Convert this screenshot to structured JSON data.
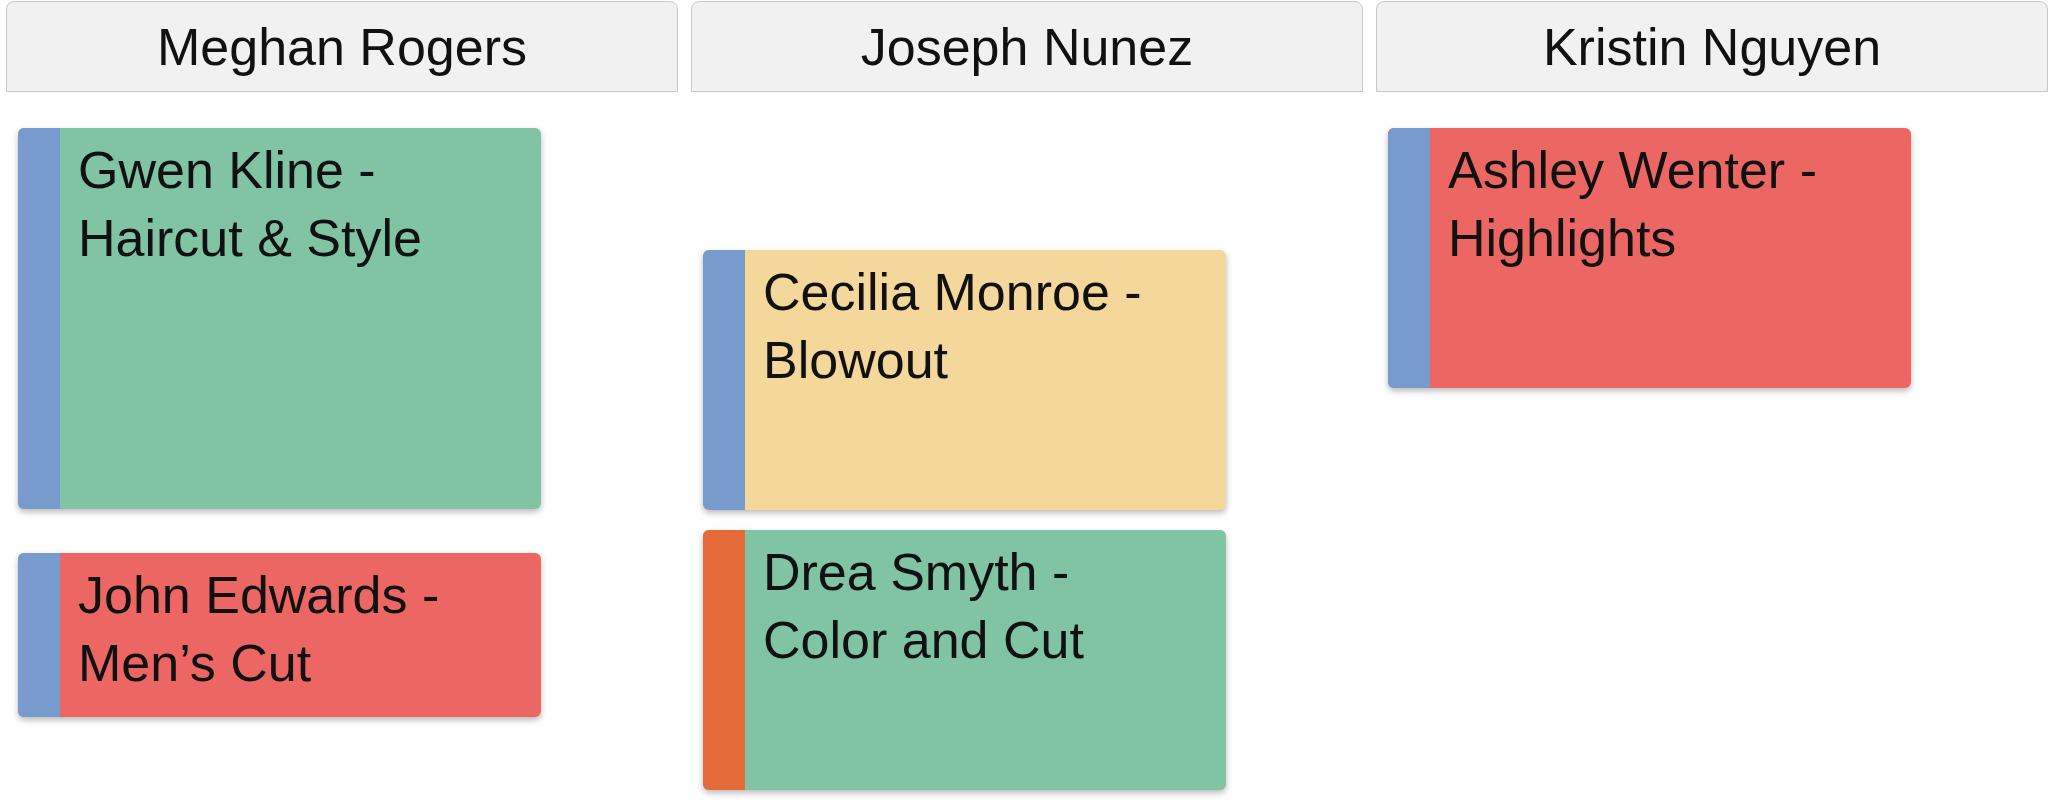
{
  "columns": [
    {
      "name": "Meghan Rogers",
      "appointments": [
        {
          "title": "Gwen Kline - Haircut & Style",
          "color": "#80c4a4",
          "stripe": {
            "color": "#789bcd"
          }
        },
        {
          "title": "John Edwards - Men’s Cut",
          "color": "#ec6664",
          "stripe": {
            "color": "#789bcd"
          }
        }
      ]
    },
    {
      "name": "Joseph Nunez",
      "appointments": [
        {
          "title": "Cecilia Monroe - Blowout",
          "color": "#f3d79b",
          "stripe": {
            "color": "#789bcd"
          }
        },
        {
          "title": "Drea Smyth - Color and Cut",
          "color": "#80c4a4",
          "stripe": {
            "color": "#e46a3a"
          }
        }
      ]
    },
    {
      "name": "Kristin Nguyen",
      "appointments": [
        {
          "title": "Ashley Wenter - Highlights",
          "color": "#ec6664",
          "stripe": {
            "color": "#789bcd"
          }
        }
      ]
    }
  ]
}
